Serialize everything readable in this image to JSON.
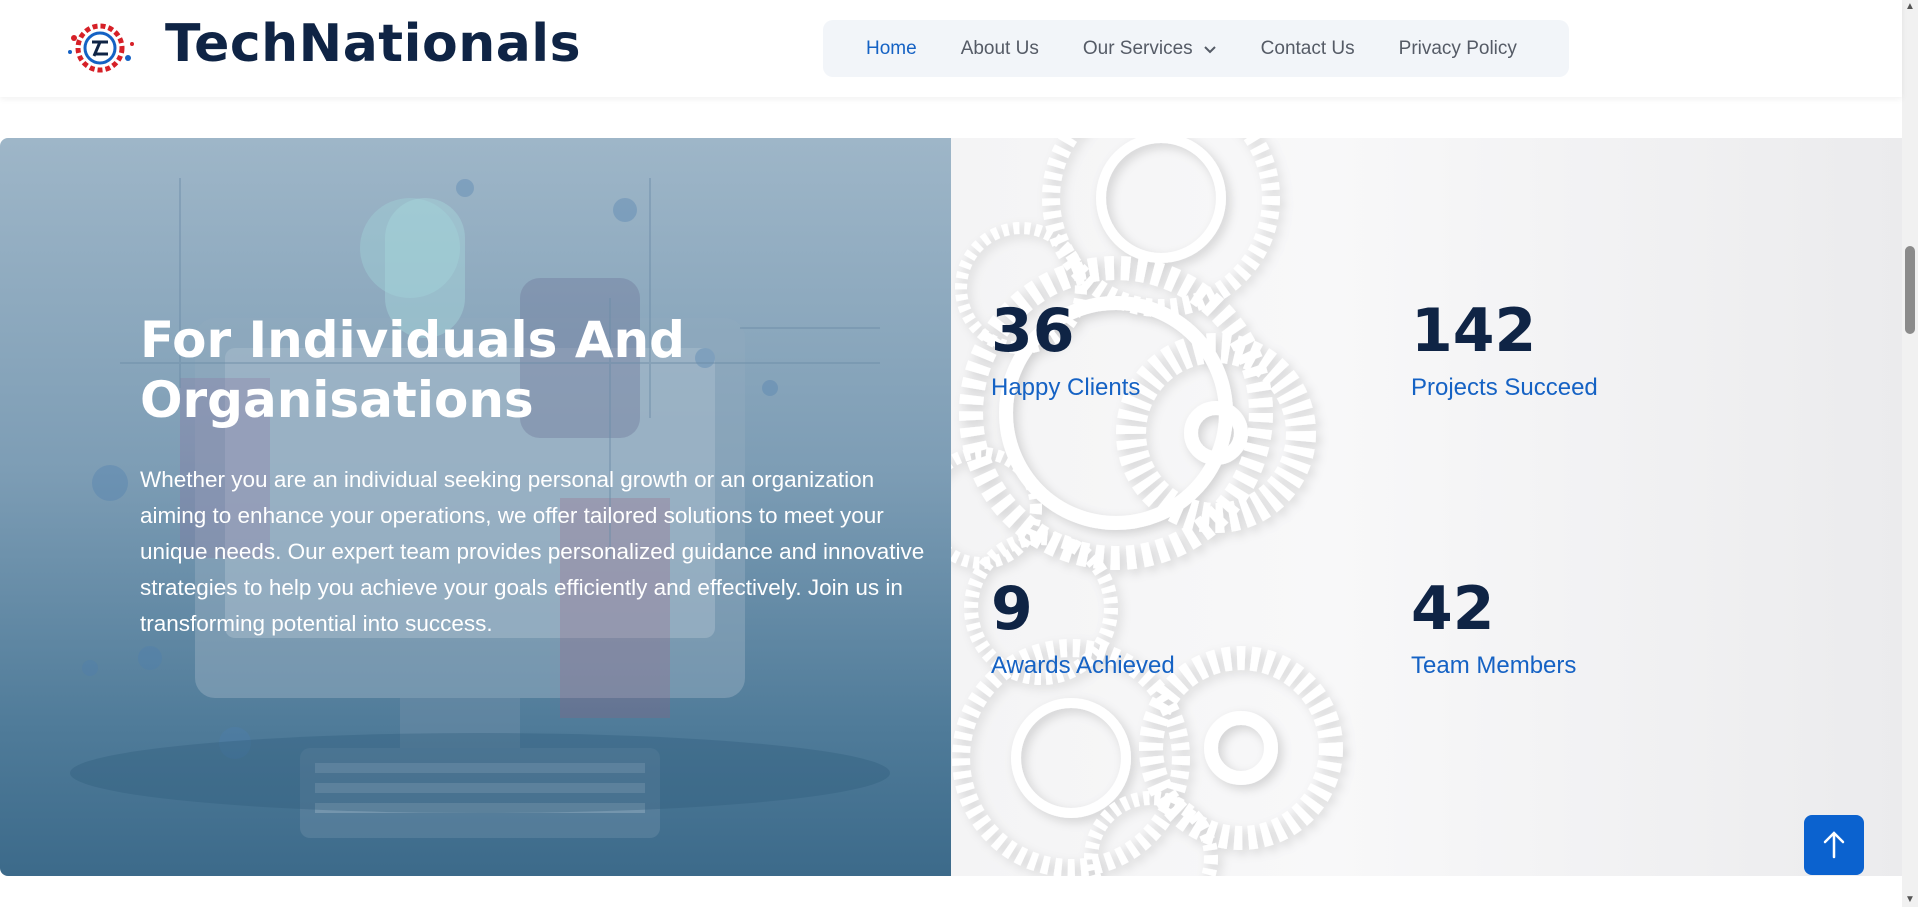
{
  "brand": {
    "name": "TechNationals",
    "logo_icon": "gear-logo-icon"
  },
  "nav": {
    "items": [
      {
        "label": "Home",
        "active": true
      },
      {
        "label": "About Us",
        "active": false
      },
      {
        "label": "Our Services",
        "active": false,
        "has_dropdown": true
      },
      {
        "label": "Contact Us",
        "active": false
      },
      {
        "label": "Privacy Policy",
        "active": false
      }
    ]
  },
  "hero": {
    "title": "For Individuals And Organisations",
    "text": "Whether you are an individual seeking personal growth or an organization aiming to enhance your operations, we offer tailored solutions to meet your unique needs. Our expert team provides personalized guidance and innovative strategies to help you achieve your goals efficiently and effectively. Join us in transforming potential into success."
  },
  "stats": [
    {
      "number": "36",
      "label": "Happy Clients"
    },
    {
      "number": "142",
      "label": "Projects Succeed"
    },
    {
      "number": "9",
      "label": "Awards Achieved"
    },
    {
      "number": "42",
      "label": "Team Members"
    }
  ],
  "back_to_top": {
    "icon": "arrow-up-icon"
  },
  "colors": {
    "brand_dark": "#0f2445",
    "accent_blue": "#1562c4",
    "button_blue": "#0b62cf"
  }
}
